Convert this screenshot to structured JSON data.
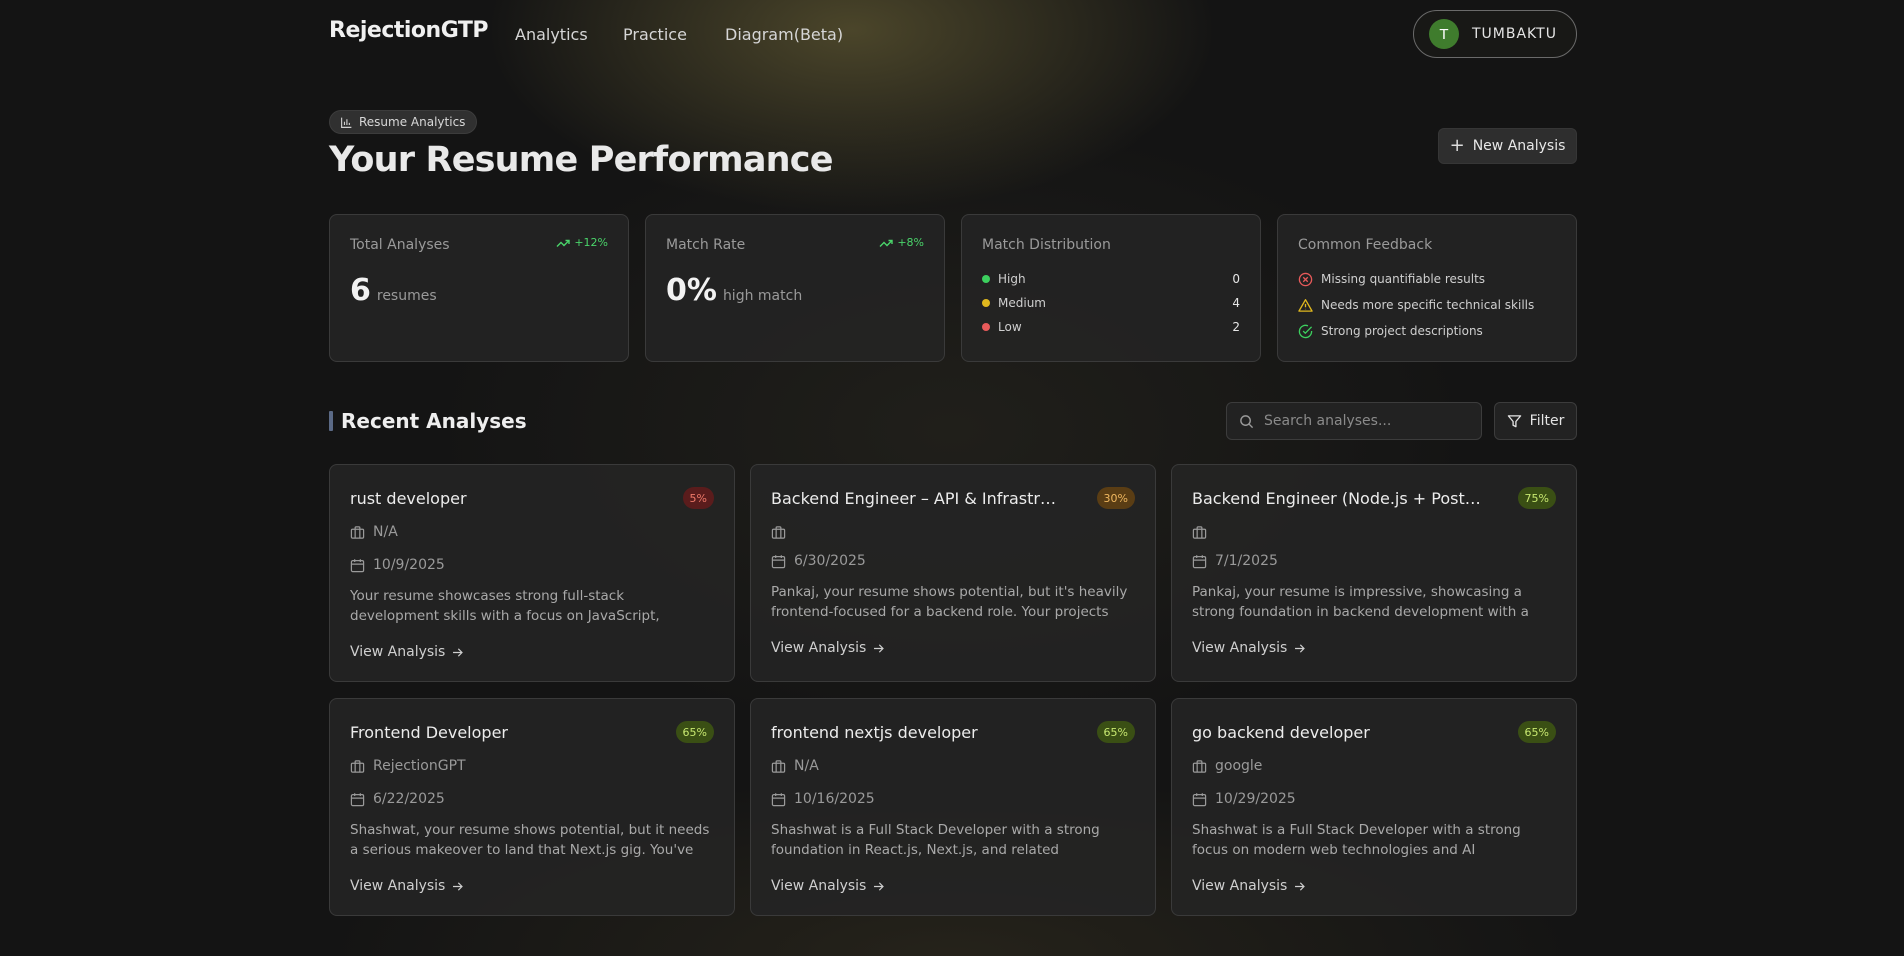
{
  "nav": {
    "brand": "RejectionGTP",
    "links": [
      "Analytics",
      "Practice",
      "Diagram(Beta)"
    ],
    "user_initial": "T",
    "user_name": "TUMBAKTU"
  },
  "header": {
    "pill": "Resume Analytics",
    "title": "Your Resume Performance",
    "new_analysis": "New Analysis"
  },
  "stats": {
    "total": {
      "label": "Total Analyses",
      "trend": "+12%",
      "value": "6",
      "unit": "resumes"
    },
    "match": {
      "label": "Match Rate",
      "trend": "+8%",
      "value": "0%",
      "unit": "high match"
    },
    "distribution": {
      "label": "Match Distribution",
      "rows": [
        {
          "label": "High",
          "count": "0",
          "color": "#3ccf5e"
        },
        {
          "label": "Medium",
          "count": "4",
          "color": "#e0b81e"
        },
        {
          "label": "Low",
          "count": "2",
          "color": "#e85a5a"
        }
      ]
    },
    "feedback": {
      "label": "Common Feedback",
      "rows": [
        {
          "text": "Missing quantifiable results",
          "icon": "x-circle-icon",
          "color": "#e85a5a"
        },
        {
          "text": "Needs more specific technical skills",
          "icon": "warning-icon",
          "color": "#e0b81e"
        },
        {
          "text": "Strong project descriptions",
          "icon": "check-circle-icon",
          "color": "#3ccf5e"
        }
      ]
    }
  },
  "recent": {
    "title": "Recent Analyses",
    "search_placeholder": "Search analyses...",
    "filter": "Filter",
    "view_label": "View Analysis",
    "cards": [
      {
        "title": "rust developer",
        "badge": "5%",
        "badge_tone": "low",
        "company": "N/A",
        "date": "10/9/2025",
        "summary": "Your resume showcases strong full-stack development skills with a focus on JavaScript, TypeScript, and related..."
      },
      {
        "title": "Backend Engineer – API & Infrastructure",
        "badge": "30%",
        "badge_tone": "medium",
        "company": "",
        "date": "6/30/2025",
        "summary": "Pankaj, your resume shows potential, but it's heavily frontend-focused for a backend role. Your projects are..."
      },
      {
        "title": "Backend Engineer (Node.js + PostgreS...",
        "badge": "75%",
        "badge_tone": "high",
        "company": "",
        "date": "7/1/2025",
        "summary": "Pankaj, your resume is impressive, showcasing a strong foundation in backend development with a focus on..."
      },
      {
        "title": "Frontend Developer",
        "badge": "65%",
        "badge_tone": "high",
        "company": "RejectionGPT",
        "date": "6/22/2025",
        "summary": "Shashwat, your resume shows potential, but it needs a serious makeover to land that Next.js gig. You've got the..."
      },
      {
        "title": "frontend nextjs developer",
        "badge": "65%",
        "badge_tone": "high",
        "company": "N/A",
        "date": "10/16/2025",
        "summary": "Shashwat is a Full Stack Developer with a strong foundation in React.js, Next.js, and related technologies...."
      },
      {
        "title": "go backend developer",
        "badge": "65%",
        "badge_tone": "high",
        "company": "google",
        "date": "10/29/2025",
        "summary": "Shashwat is a Full Stack Developer with a strong focus on modern web technologies and AI integration. He has..."
      }
    ]
  },
  "colors": {
    "badge_low_bg": "#5a1c1c",
    "badge_low_fg": "#f07a6a",
    "badge_medium_bg": "#5a3d14",
    "badge_medium_fg": "#f0b860",
    "badge_high_bg": "#3a4f14",
    "badge_high_fg": "#c8e870"
  }
}
